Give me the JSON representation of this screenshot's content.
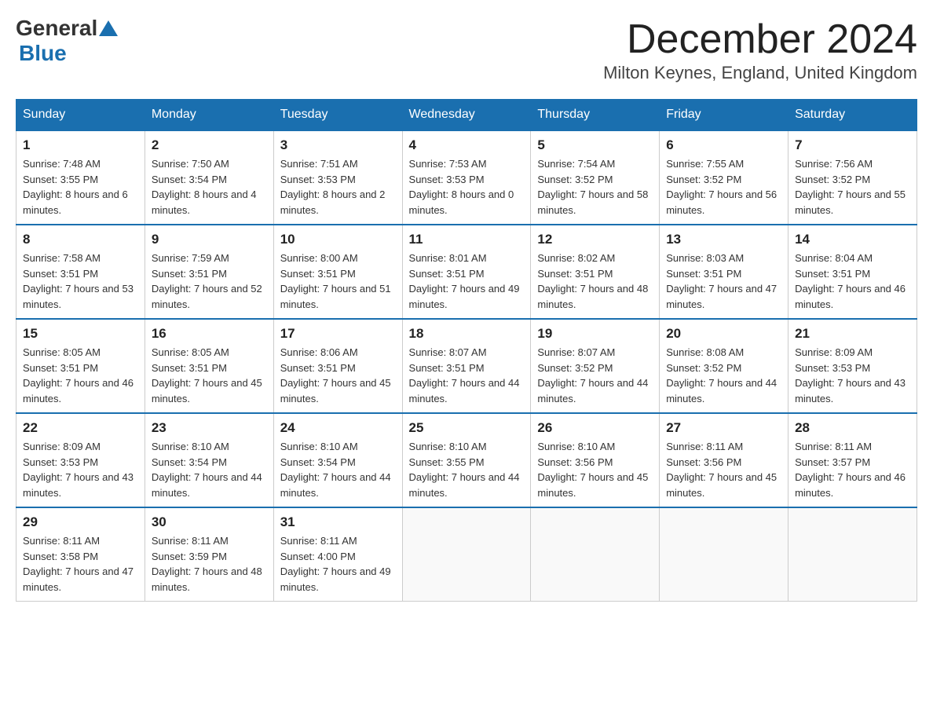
{
  "header": {
    "logo_general": "General",
    "logo_blue": "Blue",
    "month_title": "December 2024",
    "subtitle": "Milton Keynes, England, United Kingdom"
  },
  "weekdays": [
    "Sunday",
    "Monday",
    "Tuesday",
    "Wednesday",
    "Thursday",
    "Friday",
    "Saturday"
  ],
  "weeks": [
    [
      {
        "day": "1",
        "sunrise": "7:48 AM",
        "sunset": "3:55 PM",
        "daylight": "8 hours and 6 minutes."
      },
      {
        "day": "2",
        "sunrise": "7:50 AM",
        "sunset": "3:54 PM",
        "daylight": "8 hours and 4 minutes."
      },
      {
        "day": "3",
        "sunrise": "7:51 AM",
        "sunset": "3:53 PM",
        "daylight": "8 hours and 2 minutes."
      },
      {
        "day": "4",
        "sunrise": "7:53 AM",
        "sunset": "3:53 PM",
        "daylight": "8 hours and 0 minutes."
      },
      {
        "day": "5",
        "sunrise": "7:54 AM",
        "sunset": "3:52 PM",
        "daylight": "7 hours and 58 minutes."
      },
      {
        "day": "6",
        "sunrise": "7:55 AM",
        "sunset": "3:52 PM",
        "daylight": "7 hours and 56 minutes."
      },
      {
        "day": "7",
        "sunrise": "7:56 AM",
        "sunset": "3:52 PM",
        "daylight": "7 hours and 55 minutes."
      }
    ],
    [
      {
        "day": "8",
        "sunrise": "7:58 AM",
        "sunset": "3:51 PM",
        "daylight": "7 hours and 53 minutes."
      },
      {
        "day": "9",
        "sunrise": "7:59 AM",
        "sunset": "3:51 PM",
        "daylight": "7 hours and 52 minutes."
      },
      {
        "day": "10",
        "sunrise": "8:00 AM",
        "sunset": "3:51 PM",
        "daylight": "7 hours and 51 minutes."
      },
      {
        "day": "11",
        "sunrise": "8:01 AM",
        "sunset": "3:51 PM",
        "daylight": "7 hours and 49 minutes."
      },
      {
        "day": "12",
        "sunrise": "8:02 AM",
        "sunset": "3:51 PM",
        "daylight": "7 hours and 48 minutes."
      },
      {
        "day": "13",
        "sunrise": "8:03 AM",
        "sunset": "3:51 PM",
        "daylight": "7 hours and 47 minutes."
      },
      {
        "day": "14",
        "sunrise": "8:04 AM",
        "sunset": "3:51 PM",
        "daylight": "7 hours and 46 minutes."
      }
    ],
    [
      {
        "day": "15",
        "sunrise": "8:05 AM",
        "sunset": "3:51 PM",
        "daylight": "7 hours and 46 minutes."
      },
      {
        "day": "16",
        "sunrise": "8:05 AM",
        "sunset": "3:51 PM",
        "daylight": "7 hours and 45 minutes."
      },
      {
        "day": "17",
        "sunrise": "8:06 AM",
        "sunset": "3:51 PM",
        "daylight": "7 hours and 45 minutes."
      },
      {
        "day": "18",
        "sunrise": "8:07 AM",
        "sunset": "3:51 PM",
        "daylight": "7 hours and 44 minutes."
      },
      {
        "day": "19",
        "sunrise": "8:07 AM",
        "sunset": "3:52 PM",
        "daylight": "7 hours and 44 minutes."
      },
      {
        "day": "20",
        "sunrise": "8:08 AM",
        "sunset": "3:52 PM",
        "daylight": "7 hours and 44 minutes."
      },
      {
        "day": "21",
        "sunrise": "8:09 AM",
        "sunset": "3:53 PM",
        "daylight": "7 hours and 43 minutes."
      }
    ],
    [
      {
        "day": "22",
        "sunrise": "8:09 AM",
        "sunset": "3:53 PM",
        "daylight": "7 hours and 43 minutes."
      },
      {
        "day": "23",
        "sunrise": "8:10 AM",
        "sunset": "3:54 PM",
        "daylight": "7 hours and 44 minutes."
      },
      {
        "day": "24",
        "sunrise": "8:10 AM",
        "sunset": "3:54 PM",
        "daylight": "7 hours and 44 minutes."
      },
      {
        "day": "25",
        "sunrise": "8:10 AM",
        "sunset": "3:55 PM",
        "daylight": "7 hours and 44 minutes."
      },
      {
        "day": "26",
        "sunrise": "8:10 AM",
        "sunset": "3:56 PM",
        "daylight": "7 hours and 45 minutes."
      },
      {
        "day": "27",
        "sunrise": "8:11 AM",
        "sunset": "3:56 PM",
        "daylight": "7 hours and 45 minutes."
      },
      {
        "day": "28",
        "sunrise": "8:11 AM",
        "sunset": "3:57 PM",
        "daylight": "7 hours and 46 minutes."
      }
    ],
    [
      {
        "day": "29",
        "sunrise": "8:11 AM",
        "sunset": "3:58 PM",
        "daylight": "7 hours and 47 minutes."
      },
      {
        "day": "30",
        "sunrise": "8:11 AM",
        "sunset": "3:59 PM",
        "daylight": "7 hours and 48 minutes."
      },
      {
        "day": "31",
        "sunrise": "8:11 AM",
        "sunset": "4:00 PM",
        "daylight": "7 hours and 49 minutes."
      },
      null,
      null,
      null,
      null
    ]
  ],
  "labels": {
    "sunrise_prefix": "Sunrise: ",
    "sunset_prefix": "Sunset: ",
    "daylight_prefix": "Daylight: "
  }
}
